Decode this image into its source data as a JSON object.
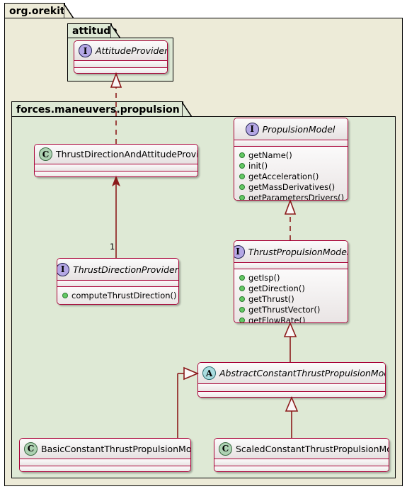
{
  "diagram": {
    "type": "uml-class-diagram",
    "packages": [
      {
        "id": "org.orekit",
        "label": "org.orekit",
        "fill": "#EDEBD8"
      },
      {
        "id": "attitude",
        "label": "attitude",
        "fill": "#DEE9D5"
      },
      {
        "id": "forces.maneuvers.propulsion",
        "label": "forces.maneuvers.propulsion",
        "fill": "#DEE9D5"
      }
    ],
    "nodes": [
      {
        "id": "AttitudeProvider",
        "name": "AttitudeProvider",
        "stereotype": "I",
        "stereotype_name": "interface-icon",
        "package": "attitude",
        "members": []
      },
      {
        "id": "ThrustDirectionAndAttitudeProvider",
        "name": "ThrustDirectionAndAttitudeProvider",
        "stereotype": "C",
        "stereotype_name": "class-icon",
        "package": "forces.maneuvers.propulsion",
        "members": []
      },
      {
        "id": "PropulsionModel",
        "name": "PropulsionModel",
        "stereotype": "I",
        "stereotype_name": "interface-icon",
        "package": "forces.maneuvers.propulsion",
        "members": [
          "getName()",
          "init()",
          "getAcceleration()",
          "getMassDerivatives()",
          "getParametersDrivers()"
        ]
      },
      {
        "id": "ThrustDirectionProvider",
        "name": "ThrustDirectionProvider",
        "stereotype": "I",
        "stereotype_name": "interface-icon",
        "package": "forces.maneuvers.propulsion",
        "members": [
          "computeThrustDirection()"
        ]
      },
      {
        "id": "ThrustPropulsionModel",
        "name": "ThrustPropulsionModel",
        "stereotype": "I",
        "stereotype_name": "interface-icon",
        "package": "forces.maneuvers.propulsion",
        "members": [
          "getIsp()",
          "getDirection()",
          "getThrust()",
          "getThrustVector()",
          "getFlowRate()"
        ]
      },
      {
        "id": "AbstractConstantThrustPropulsionModel",
        "name": "AbstractConstantThrustPropulsionModel",
        "stereotype": "A",
        "stereotype_name": "abstract-class-icon",
        "package": "forces.maneuvers.propulsion",
        "members": []
      },
      {
        "id": "BasicConstantThrustPropulsionModel",
        "name": "BasicConstantThrustPropulsionModel",
        "stereotype": "C",
        "stereotype_name": "class-icon",
        "package": "forces.maneuvers.propulsion",
        "members": []
      },
      {
        "id": "ScaledConstantThrustPropulsionModel",
        "name": "ScaledConstantThrustPropulsionModel",
        "stereotype": "C",
        "stereotype_name": "class-icon",
        "package": "forces.maneuvers.propulsion",
        "members": []
      }
    ],
    "edges": [
      {
        "from": "ThrustDirectionAndAttitudeProvider",
        "to": "AttitudeProvider",
        "kind": "realization",
        "style": "dashed",
        "head": "hollow-triangle",
        "label": ""
      },
      {
        "from": "ThrustDirectionProvider",
        "to": "ThrustDirectionAndAttitudeProvider",
        "kind": "association",
        "style": "solid",
        "head": "filled-arrow",
        "label": "1"
      },
      {
        "from": "ThrustPropulsionModel",
        "to": "PropulsionModel",
        "kind": "realization",
        "style": "dashed",
        "head": "hollow-triangle",
        "label": ""
      },
      {
        "from": "AbstractConstantThrustPropulsionModel",
        "to": "ThrustPropulsionModel",
        "kind": "realization",
        "style": "solid",
        "head": "hollow-triangle",
        "label": ""
      },
      {
        "from": "BasicConstantThrustPropulsionModel",
        "to": "AbstractConstantThrustPropulsionModel",
        "kind": "generalization",
        "style": "solid",
        "head": "hollow-triangle",
        "label": ""
      },
      {
        "from": "ScaledConstantThrustPropulsionModel",
        "to": "AbstractConstantThrustPropulsionModel",
        "kind": "generalization",
        "style": "solid",
        "head": "hollow-triangle",
        "label": ""
      }
    ],
    "colors": {
      "outer_package_fill": "#EDEBD8",
      "inner_package_fill": "#DEE9D5",
      "node_border": "#A80036",
      "edge_stroke": "#8B1A1A",
      "interface_icon_fill": "#B4A7E5",
      "class_icon_fill": "#ADD1B2",
      "abstract_icon_fill": "#A9DCDF",
      "visibility_public_dot": "#64C864"
    },
    "multiplicities": {
      "thrust_direction_provider_to_provider": "1"
    }
  }
}
